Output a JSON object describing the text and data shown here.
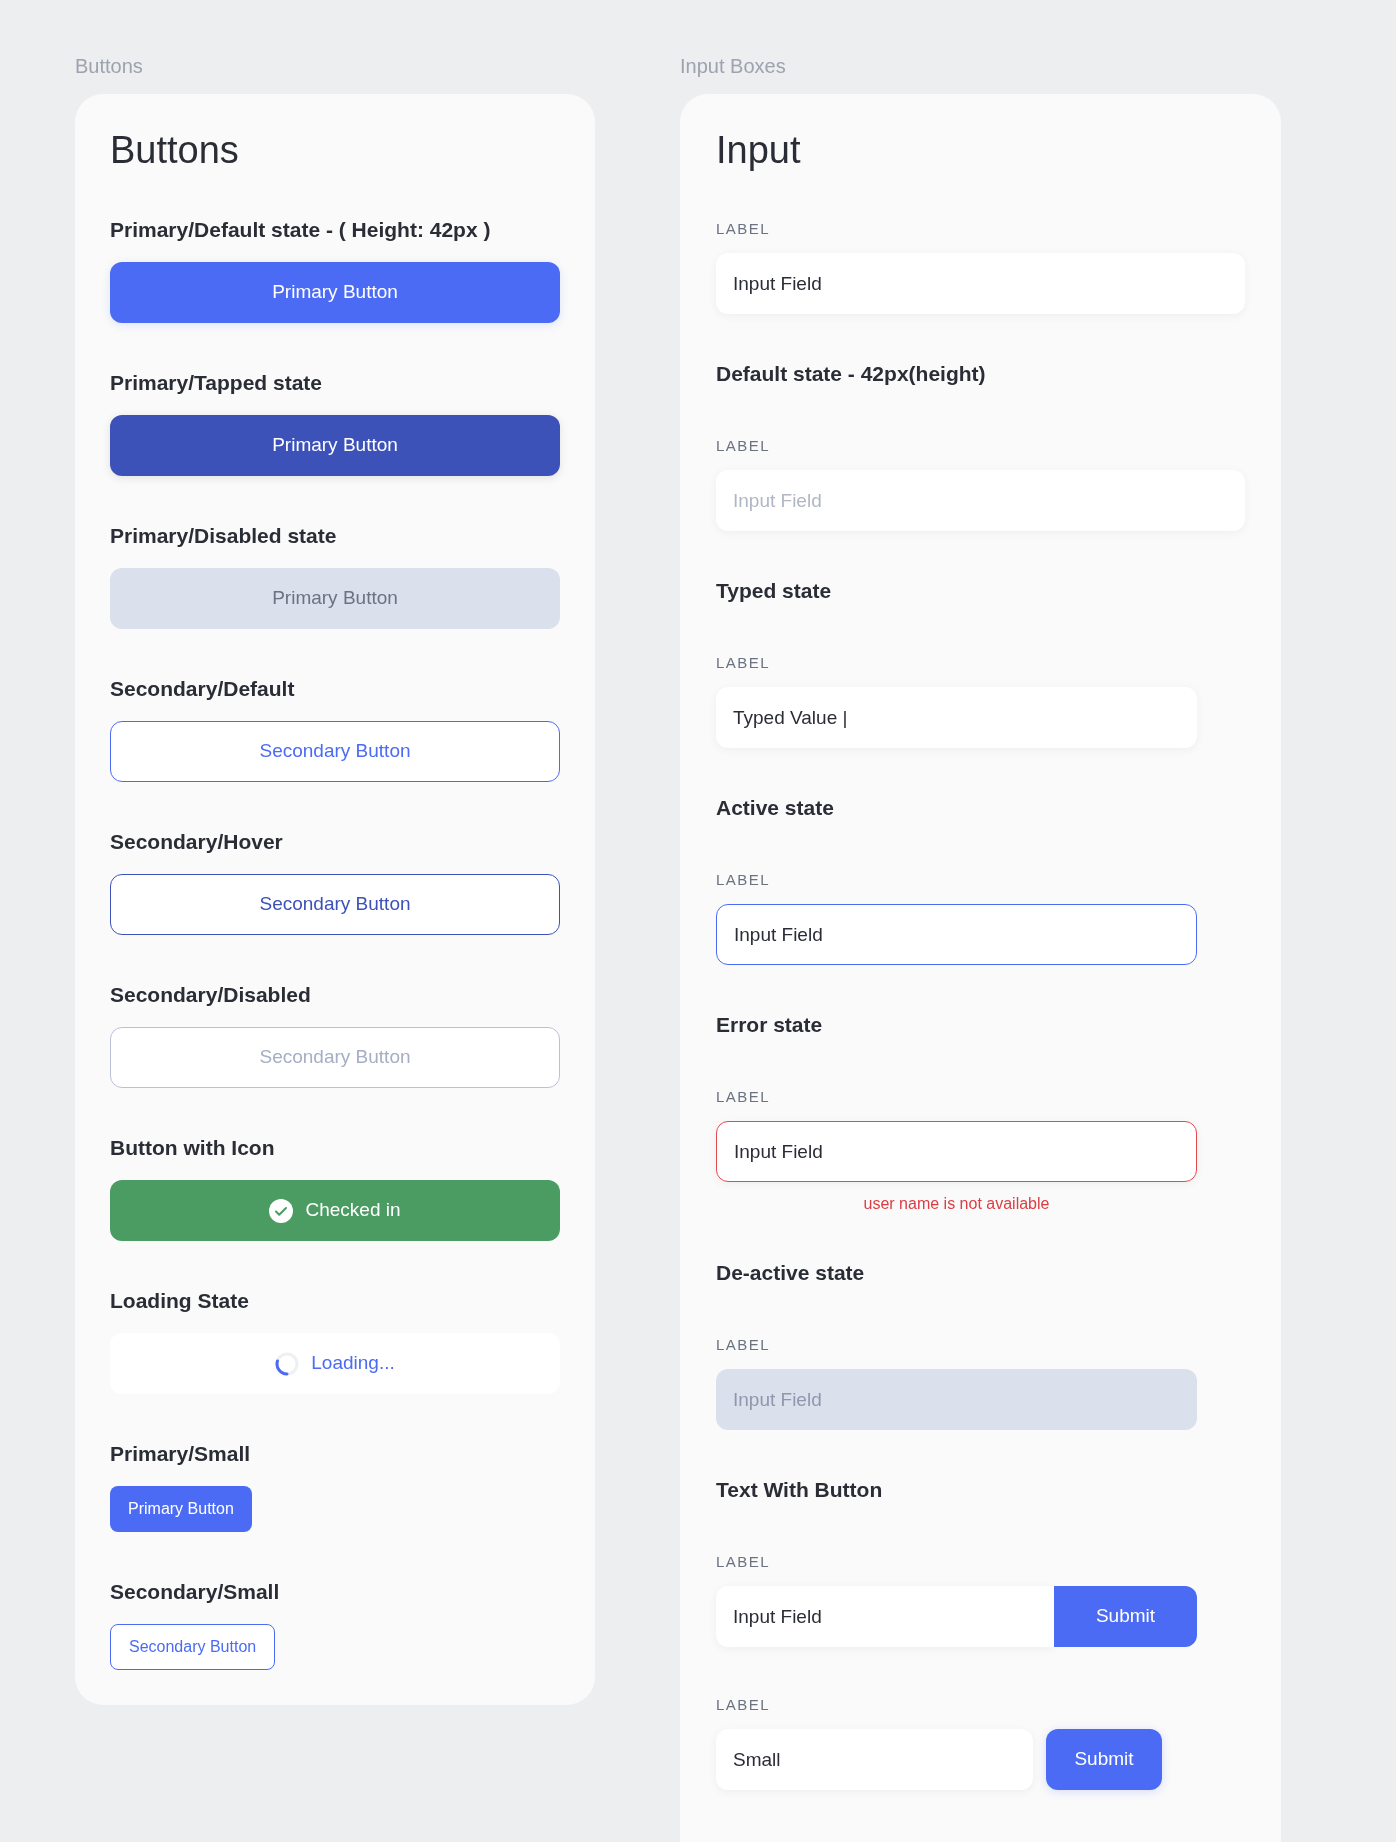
{
  "buttons_panel": {
    "caption": "Buttons",
    "title": "Buttons",
    "sections": [
      {
        "heading": "Primary/Default state - ( Height: 42px )",
        "button": {
          "kind": "primary",
          "label": "Primary Button"
        }
      },
      {
        "heading": "Primary/Tapped state",
        "button": {
          "kind": "primary_tapped",
          "label": "Primary Button"
        }
      },
      {
        "heading": "Primary/Disabled state",
        "button": {
          "kind": "primary_disabled",
          "label": "Primary Button"
        }
      },
      {
        "heading": "Secondary/Default",
        "button": {
          "kind": "secondary",
          "label": "Secondary Button"
        }
      },
      {
        "heading": "Secondary/Hover",
        "button": {
          "kind": "secondary_hover",
          "label": "Secondary Button"
        }
      },
      {
        "heading": "Secondary/Disabled",
        "button": {
          "kind": "secondary_disabled",
          "label": "Secondary Button"
        }
      },
      {
        "heading": "Button with Icon",
        "button": {
          "kind": "success_icon",
          "label": "Checked in"
        }
      },
      {
        "heading": "Loading State",
        "button": {
          "kind": "loading",
          "label": "Loading..."
        }
      },
      {
        "heading": "Primary/Small",
        "button": {
          "kind": "primary_small",
          "label": "Primary Button"
        }
      },
      {
        "heading": "Secondary/Small",
        "button": {
          "kind": "secondary_small",
          "label": "Secondary Button"
        }
      }
    ]
  },
  "inputs_panel": {
    "caption": "Input Boxes",
    "title": "Input",
    "fields": [
      {
        "label": "LABEL",
        "kind": "filled",
        "value": "Input Field"
      },
      {
        "heading": "Default state - 42px(height)",
        "label": "LABEL",
        "kind": "empty",
        "placeholder": "Input Field"
      },
      {
        "heading": "Typed state",
        "label": "LABEL",
        "kind": "typed",
        "value": "Typed Value |"
      },
      {
        "heading": "Active state",
        "label": "LABEL",
        "kind": "active",
        "value": "Input Field"
      },
      {
        "heading": "Error state",
        "label": "LABEL",
        "kind": "error",
        "value": "Input Field",
        "error": "user name is not available"
      },
      {
        "heading": "De-active state",
        "label": "LABEL",
        "kind": "disabled",
        "placeholder": "Input Field"
      },
      {
        "heading": "Text With Button",
        "label": "LABEL",
        "kind": "with_button",
        "value": "Input Field",
        "button": "Submit"
      },
      {
        "label": "LABEL",
        "kind": "small_with_button",
        "value": "Small",
        "button": "Submit"
      }
    ]
  }
}
